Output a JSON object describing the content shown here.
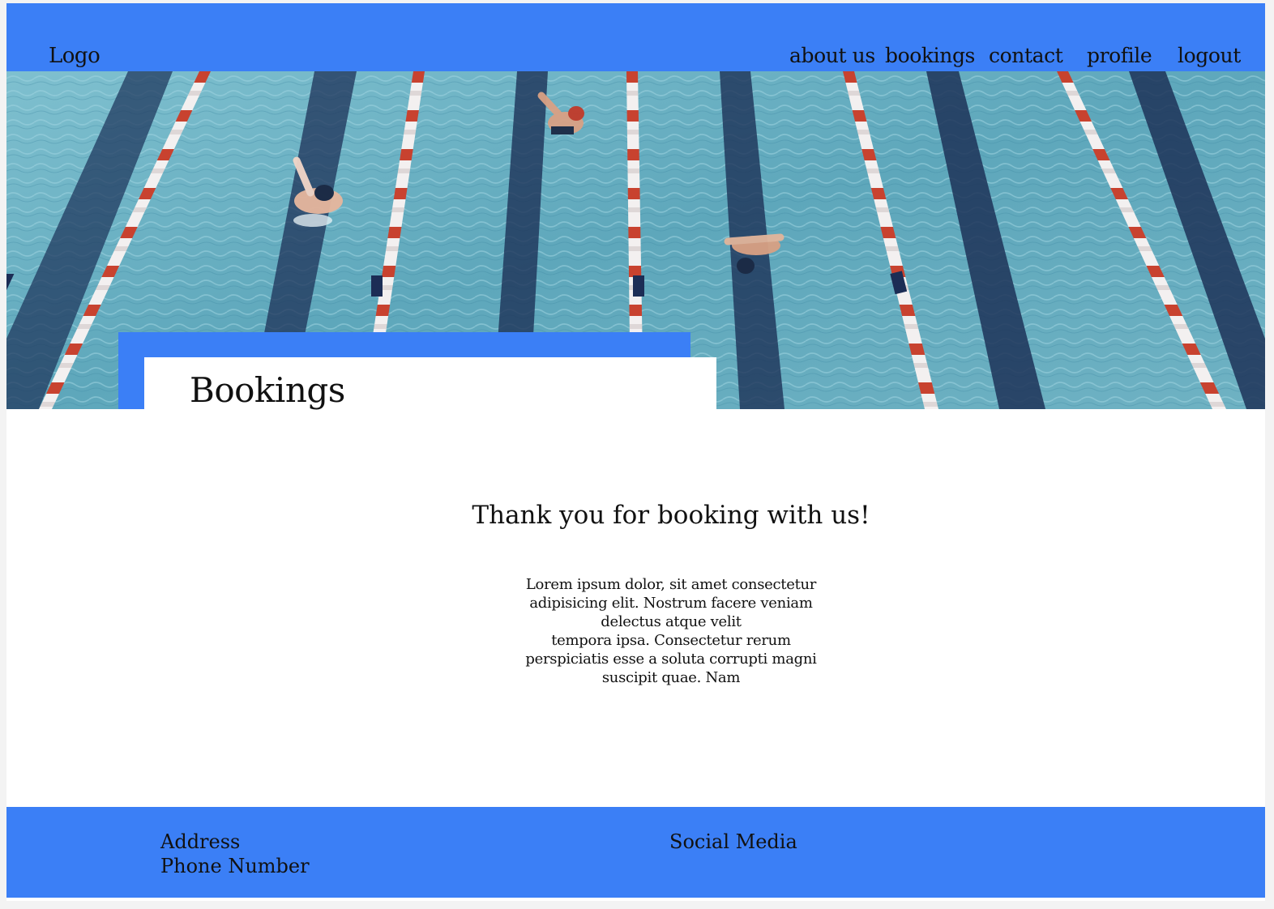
{
  "header": {
    "logo": "Logo",
    "nav": [
      {
        "label": "about us"
      },
      {
        "label": "bookings"
      },
      {
        "label": "contact"
      },
      {
        "label": "profile"
      },
      {
        "label": "logout"
      }
    ]
  },
  "hero": {
    "image": "swimming-pool-lanes-photo",
    "title": "Bookings"
  },
  "main": {
    "heading": "Thank you for booking with us!",
    "paragraph_lines": [
      "Lorem ipsum dolor, sit amet consectetur",
      "adipisicing elit. Nostrum facere veniam",
      "delectus atque velit",
      "tempora ipsa. Consectetur rerum",
      "perspiciatis esse a soluta corrupti magni",
      "suscipit quae. Nam"
    ]
  },
  "footer": {
    "address": "Address",
    "phone": "Phone Number",
    "social": "Social Media"
  },
  "colors": {
    "accent_blue": "#3b7ff6",
    "pool_water": "#6fb3c4",
    "lane_red": "#c8422f",
    "lane_navy": "#1c2d55"
  }
}
